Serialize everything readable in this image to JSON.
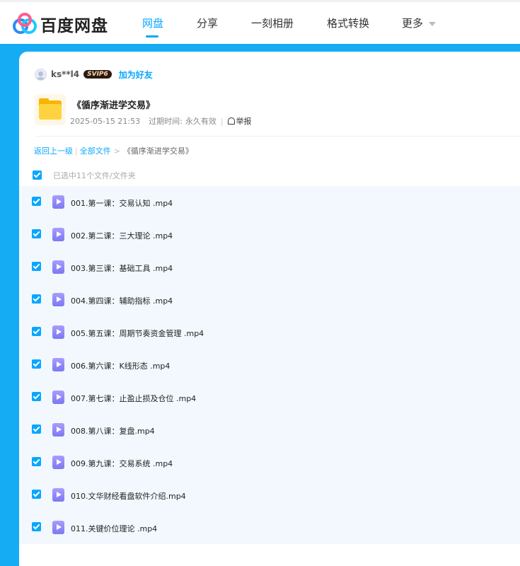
{
  "header": {
    "logo_text": "百度网盘",
    "nav": [
      {
        "label": "网盘",
        "active": true
      },
      {
        "label": "分享",
        "active": false
      },
      {
        "label": "一刻相册",
        "active": false
      },
      {
        "label": "格式转换",
        "active": false
      },
      {
        "label": "更多",
        "active": false
      }
    ]
  },
  "sharer": {
    "username": "ks**l4",
    "vip_badge": "SVIP6",
    "add_friend": "加为好友"
  },
  "share": {
    "title": "《循序渐进学交易》",
    "date": "2025-05-15 21:53",
    "expire_label": "过期时间:",
    "expire_value": "永久有效",
    "report": "举报"
  },
  "breadcrumb": {
    "back": "返回上一级",
    "all": "全部文件",
    "current": "《循序渐进学交易》"
  },
  "selection": {
    "text": "已选中11个文件/文件夹"
  },
  "files": [
    {
      "name": "001.第一课：交易认知 .mp4"
    },
    {
      "name": "002.第二课：三大理论 .mp4"
    },
    {
      "name": "003.第三课：基础工具 .mp4"
    },
    {
      "name": "004.第四课：辅助指标 .mp4"
    },
    {
      "name": "005.第五课：周期节奏资金管理 .mp4"
    },
    {
      "name": "006.第六课：K线形态 .mp4"
    },
    {
      "name": "007.第七课：止盈止损及仓位 .mp4"
    },
    {
      "name": "008.第八课：复盘.mp4"
    },
    {
      "name": "009.第九课：交易系统 .mp4"
    },
    {
      "name": "010.文华财经看盘软件介绍.mp4"
    },
    {
      "name": "011.关键价位理论 .mp4"
    }
  ],
  "colors": {
    "accent": "#06a7ff",
    "backdrop": "#16acf4",
    "list_bg": "#f2f8fd"
  }
}
